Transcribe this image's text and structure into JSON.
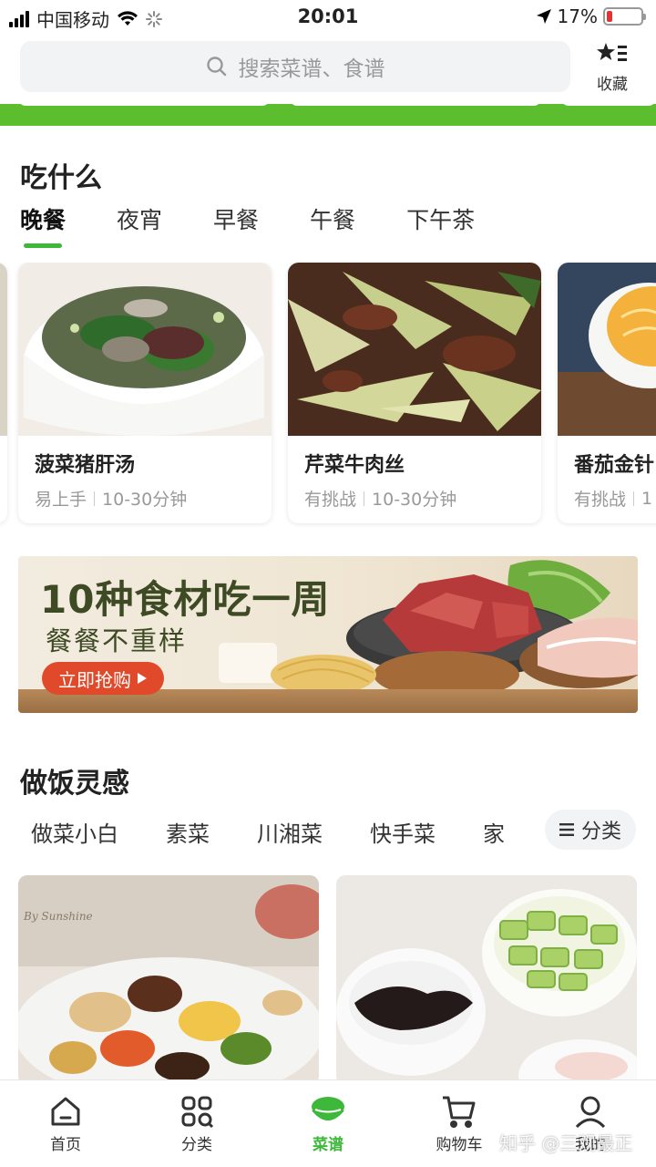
{
  "status_bar": {
    "carrier": "中国移动",
    "time": "20:01",
    "battery": "17%",
    "battery_level": 0.17
  },
  "header": {
    "search_placeholder": "搜索菜谱、食谱",
    "favorites_label": "收藏"
  },
  "what_to_eat": {
    "title": "吃什么",
    "tabs": [
      {
        "label": "晚餐",
        "active": true
      },
      {
        "label": "夜宵",
        "active": false
      },
      {
        "label": "早餐",
        "active": false
      },
      {
        "label": "午餐",
        "active": false
      },
      {
        "label": "下午茶",
        "active": false
      }
    ],
    "cards": [
      {
        "name": "菠菜猪肝汤",
        "difficulty": "易上手",
        "time": "10-30分钟"
      },
      {
        "name": "芹菜牛肉丝",
        "difficulty": "有挑战",
        "time": "10-30分钟"
      },
      {
        "name": "番茄金针",
        "difficulty": "有挑战",
        "time": "1"
      }
    ]
  },
  "banner": {
    "title": "10种食材吃一周",
    "subtitle": "餐餐不重样",
    "button": "立即抢购"
  },
  "inspiration": {
    "title": "做饭灵感",
    "tabs": [
      "做菜小白",
      "素菜",
      "川湘菜",
      "快手菜",
      "家"
    ],
    "category_button": "分类",
    "image_overlay_text": "By Sunshine"
  },
  "bottom_nav": [
    {
      "label": "首页",
      "icon": "home-icon",
      "active": false
    },
    {
      "label": "分类",
      "icon": "category-grid-icon",
      "active": false
    },
    {
      "label": "菜谱",
      "icon": "recipe-bowl-icon",
      "active": true
    },
    {
      "label": "购物车",
      "icon": "cart-icon",
      "active": false
    },
    {
      "label": "我的",
      "icon": "profile-icon",
      "active": false
    }
  ],
  "watermark": "知乎 @三观最正",
  "colors": {
    "accent_green": "#3db83a",
    "banner_button": "#e04a2a",
    "battery_low": "#e33333"
  }
}
